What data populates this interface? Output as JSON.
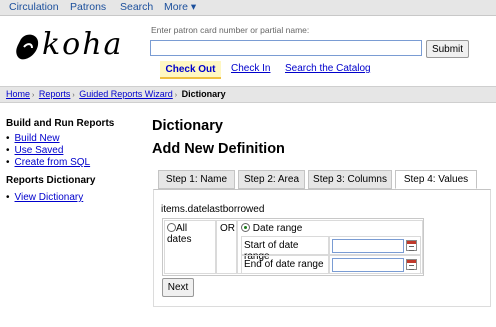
{
  "nav": {
    "items": [
      "Circulation",
      "Patrons",
      "Search",
      "More ▾"
    ]
  },
  "logo": {
    "text": "koha"
  },
  "search": {
    "label": "Enter patron card number or partial name:",
    "value": "",
    "submit_label": "Submit",
    "tabs": [
      "Check Out",
      "Check In",
      "Search the Catalog"
    ],
    "active_tab": "Check Out"
  },
  "breadcrumb": [
    "Home",
    "Reports",
    "Guided Reports Wizard",
    "Dictionary"
  ],
  "sidebar": {
    "section1_title": "Build and Run Reports",
    "section1_items": [
      "Build New",
      "Use Saved",
      "Create from SQL"
    ],
    "section2_title": "Reports Dictionary",
    "section2_items": [
      "View Dictionary"
    ]
  },
  "main": {
    "title": "Dictionary",
    "subtitle": "Add New Definition",
    "steps": [
      "Step 1: Name",
      "Step 2: Area",
      "Step 3: Columns",
      "Step 4: Values"
    ],
    "active_step": "Step 4: Values",
    "field": "items.datelastborrowed",
    "all_dates_label": "All dates",
    "or_label": "OR",
    "date_range_label": "Date range",
    "start_label": "Start of date range",
    "end_label": "End of date range",
    "start_value": "",
    "end_value": "",
    "selected_option": "Date range",
    "next_label": "Next"
  },
  "colors": {
    "nav_bar": "#e6e6e6",
    "link": "#0000cc",
    "active_tab_bg": "#fff7c2",
    "active_tab_underline": "#f0c040",
    "input_border": "#7a9cd3"
  },
  "icons": [
    "koha-logo-icon",
    "calendar-icon"
  ]
}
